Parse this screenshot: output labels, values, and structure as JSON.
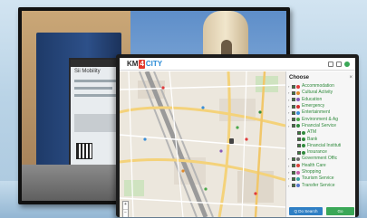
{
  "app": {
    "logo_km": "KM",
    "logo_four": "4",
    "logo_city": "CITY"
  },
  "kiosk": {
    "title": "Sii Mobility"
  },
  "panel": {
    "title": "Choose",
    "close": "×",
    "categories": [
      {
        "label": "Accommodation",
        "color": "#e03b3b",
        "sub": false,
        "checked": true
      },
      {
        "label": "Cultural Activity",
        "color": "#e08a2b",
        "sub": false,
        "checked": true
      },
      {
        "label": "Education",
        "color": "#8a5ab8",
        "sub": false,
        "checked": true
      },
      {
        "label": "Emergency",
        "color": "#d42f2f",
        "sub": false,
        "checked": true
      },
      {
        "label": "Entertainment",
        "color": "#3b8ed8",
        "sub": false,
        "checked": true
      },
      {
        "label": "Environment & Ag",
        "color": "#4aa84a",
        "sub": false,
        "checked": true
      },
      {
        "label": "Financial Service",
        "color": "#2f8a3c",
        "sub": false,
        "checked": true
      },
      {
        "label": "ATM",
        "color": "#2f8a3c",
        "sub": true,
        "checked": true
      },
      {
        "label": "Bank",
        "color": "#2f8a3c",
        "sub": true,
        "checked": true
      },
      {
        "label": "Financial Instituti",
        "color": "#2f8a3c",
        "sub": true,
        "checked": true
      },
      {
        "label": "Insurance",
        "color": "#2f8a3c",
        "sub": true,
        "checked": true
      },
      {
        "label": "Government Offic",
        "color": "#6a6a6a",
        "sub": false,
        "checked": true
      },
      {
        "label": "Health Care",
        "color": "#d9443a",
        "sub": false,
        "checked": true
      },
      {
        "label": "Shopping",
        "color": "#c65fa8",
        "sub": false,
        "checked": true
      },
      {
        "label": "Tourism Service",
        "color": "#3aa0a0",
        "sub": false,
        "checked": true
      },
      {
        "label": "Transfer Service",
        "color": "#5577cc",
        "sub": false,
        "checked": true
      }
    ],
    "search_button": "Q Do Search",
    "go_button": "Go"
  },
  "map": {
    "zoom_in": "+",
    "zoom_out": "−"
  }
}
